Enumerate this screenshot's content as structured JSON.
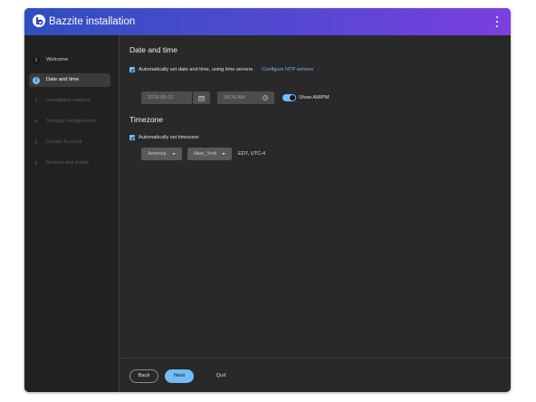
{
  "header": {
    "title": "Bazzite installation",
    "logo_icon": "bazzite-logo-icon",
    "menu_icon": "kebab-menu-icon"
  },
  "steps": [
    {
      "num": "1",
      "label": "Welcome",
      "state": "done"
    },
    {
      "num": "2",
      "label": "Date and time",
      "state": "active"
    },
    {
      "num": "3",
      "label": "Installation method",
      "state": "disabled"
    },
    {
      "num": "4",
      "label": "Storage configuration",
      "state": "disabled"
    },
    {
      "num": "5",
      "label": "Create Account",
      "state": "disabled"
    },
    {
      "num": "6",
      "label": "Review and install",
      "state": "disabled"
    }
  ],
  "datetime": {
    "heading": "Date and time",
    "auto_label": "Automatically set date and time, using time servers",
    "auto_checked": true,
    "ntp_link": "Configure NTP servers",
    "date_value": "2026-05-12",
    "time_value": "08:36 AM",
    "ampm_label": "Show AM/PM",
    "ampm_on": true
  },
  "timezone": {
    "heading": "Timezone",
    "auto_label": "Automatically set timezone",
    "auto_checked": true,
    "region": "America",
    "city": "New_York",
    "info": "EDT, UTC-4"
  },
  "footer": {
    "back": "Back",
    "next": "Next",
    "quit": "Quit"
  },
  "colors": {
    "accent": "#73bcf7",
    "background": "#292929",
    "sidebar": "#212121",
    "header_start": "#2f4fbf",
    "header_end": "#7b3fe0"
  }
}
